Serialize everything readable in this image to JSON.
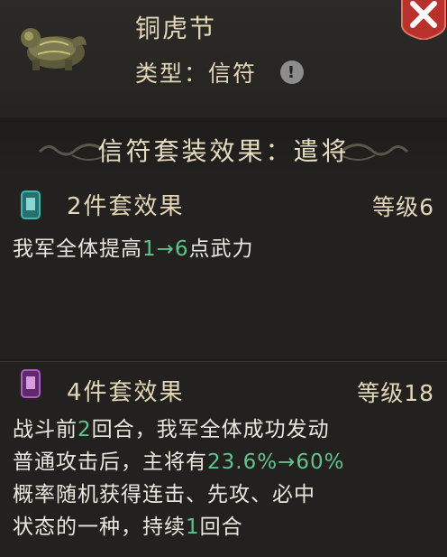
{
  "item": {
    "name": "铜虎节",
    "type_label": "类型：",
    "type_value": "信符",
    "info_icon": "!"
  },
  "section_title": "信符套装效果：遣将",
  "sets": [
    {
      "title": "2件套效果",
      "level": "等级6",
      "badge_color": "#3fb5b0",
      "desc": [
        {
          "text": "我军全体提高",
          "green": false
        },
        {
          "text": "1→6",
          "green": true
        },
        {
          "text": "点武力",
          "green": false
        }
      ]
    },
    {
      "title": "4件套效果",
      "level": "等级18",
      "badge_color": "#b05cc4",
      "desc_lines": [
        [
          {
            "text": "战斗前",
            "green": false
          },
          {
            "text": "2",
            "green": true
          },
          {
            "text": "回合，我军全体成功发动",
            "green": false
          }
        ],
        [
          {
            "text": "普通攻击后，主将有",
            "green": false
          },
          {
            "text": "23.6%→60%",
            "green": true
          }
        ],
        [
          {
            "text": "概率随机获得连击、先攻、必中",
            "green": false
          }
        ],
        [
          {
            "text": "状态的一种，持续",
            "green": false
          },
          {
            "text": "1",
            "green": true
          },
          {
            "text": "回合",
            "green": false
          }
        ]
      ]
    }
  ],
  "colors": {
    "accent_text": "#e3d7b8",
    "highlight_green": "#5fc38a",
    "close_red": "#b8312b"
  },
  "icons": {
    "item": "bronze-tiger-tally-icon",
    "close": "close-icon",
    "info": "info-icon",
    "set_badge": "token-badge-icon"
  }
}
